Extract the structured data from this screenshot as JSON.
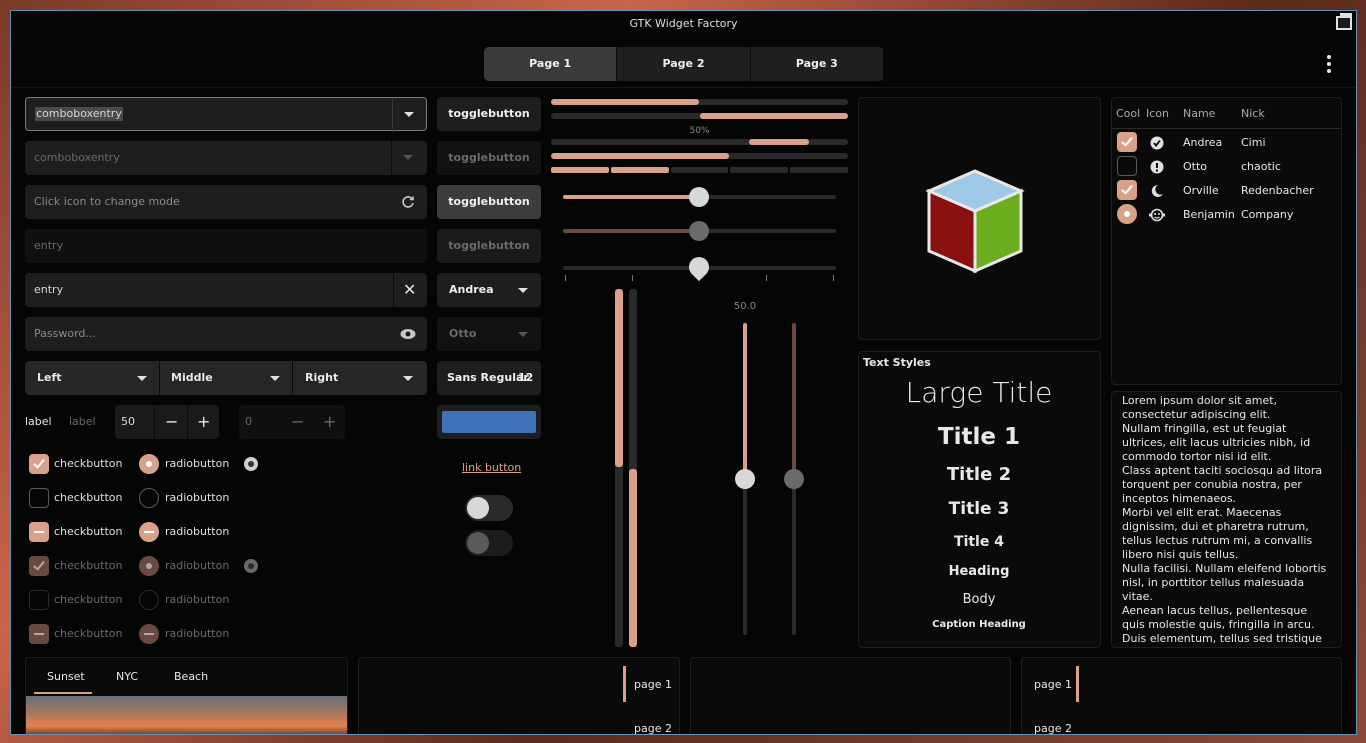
{
  "window": {
    "title": "GTK Widget Factory"
  },
  "page_tabs": [
    "Page 1",
    "Page 2",
    "Page 3"
  ],
  "left": {
    "combo1": "comboboxentry",
    "combo2": "comboboxentry",
    "mode_entry_placeholder": "Click icon to change mode",
    "entry_disabled_placeholder": "entry",
    "entry_value": "entry",
    "password_placeholder": "Password...",
    "segments": [
      "Left",
      "Middle",
      "Right"
    ],
    "label1": "label",
    "label2": "label",
    "spin1": "50",
    "spin2": "0",
    "checkbutton": "checkbutton",
    "radiobutton": "radiobutton"
  },
  "middle": {
    "togglebutton": "togglebutton",
    "combo_andrea": "Andrea",
    "combo_otto": "Otto",
    "font_name": "Sans Regular",
    "font_size": "12",
    "color_swatch": "#3d72b8",
    "link_button": "link button",
    "switch_states": [
      "off",
      "off"
    ]
  },
  "progress": {
    "label": "50%",
    "bar_values": [
      0.5,
      0.5,
      0.6,
      0.6
    ],
    "scale_label": "50.0",
    "slider_values": [
      0.5,
      0.5,
      0.5
    ],
    "vertical_scale_values": [
      0.5,
      0.5
    ]
  },
  "text_styles": {
    "heading": "Text Styles",
    "large_title": "Large Title",
    "title1": "Title 1",
    "title2": "Title 2",
    "title3": "Title 3",
    "title4": "Title 4",
    "heading_style": "Heading",
    "body": "Body",
    "caption_heading": "Caption Heading"
  },
  "tree": {
    "columns": [
      "Cool",
      "Icon",
      "Name",
      "Nick"
    ],
    "rows": [
      {
        "cool": "checked",
        "icon": "check-circle-icon",
        "name": "Andrea",
        "nick": "Cimi"
      },
      {
        "cool": "unchecked",
        "icon": "exclamation-icon",
        "name": "Otto",
        "nick": "chaotic"
      },
      {
        "cool": "checked",
        "icon": "moon-icon",
        "name": "Orville",
        "nick": "Redenbacher"
      },
      {
        "cool": "radio",
        "icon": "face-icon",
        "name": "Benjamin",
        "nick": "Company"
      }
    ]
  },
  "lorem": [
    "Lorem ipsum dolor sit amet, consectetur adipiscing elit.",
    "Nullam fringilla, est ut feugiat ultrices, elit lacus ultricies nibh, id commodo tortor nisi id elit.",
    "Class aptent taciti sociosqu ad litora torquent per conubia nostra, per inceptos himenaeos.",
    "Morbi vel elit erat. Maecenas dignissim, dui et pharetra rutrum, tellus lectus rutrum mi, a convallis libero nisi quis tellus.",
    "Nulla facilisi. Nullam eleifend lobortis nisl, in porttitor tellus malesuada vitae.",
    "Aenean lacus tellus, pellentesque quis molestie quis, fringilla in arcu.",
    "Duis elementum, tellus sed tristique semper, metus metus accumsan augue, et"
  ],
  "bottom": {
    "photo_tabs": [
      "Sunset",
      "NYC",
      "Beach"
    ],
    "side_tabs": [
      "page 1",
      "page 2"
    ]
  }
}
